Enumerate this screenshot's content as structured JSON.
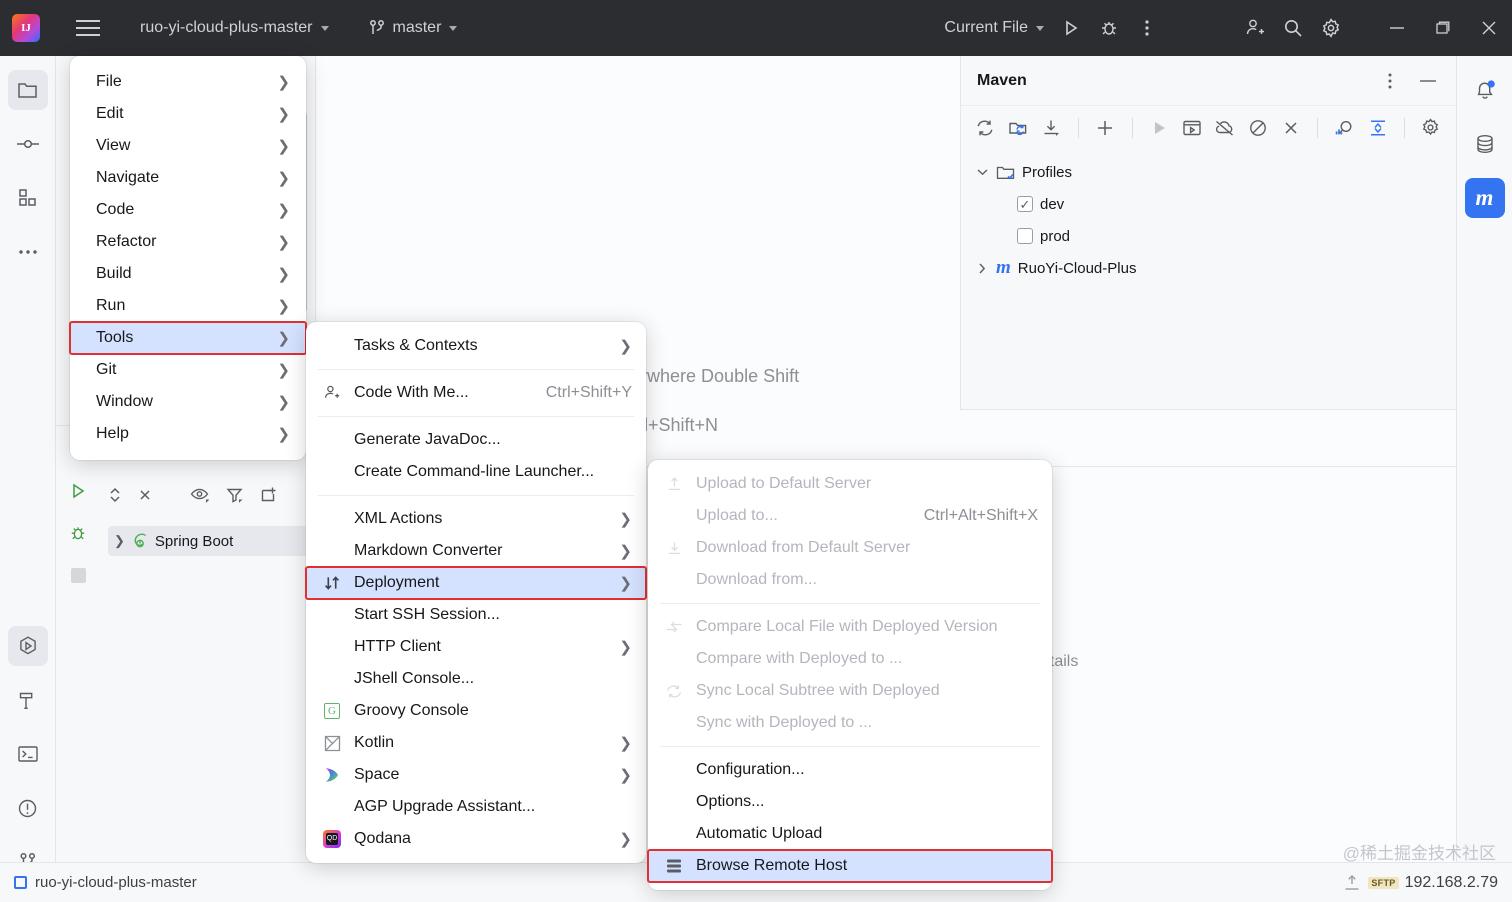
{
  "titlebar": {
    "logo_alt": "intellij-idea-logo",
    "project_name": "ruo-yi-cloud-plus-master",
    "branch": "master",
    "run_config": "Current File",
    "icons": {
      "hamburger": "hamburger-menu-icon",
      "run": "run-icon",
      "debug": "debug-icon",
      "more": "more-vertical-icon",
      "add_user": "add-user-icon",
      "search": "search-icon",
      "settings": "gear-icon",
      "minimize": "minimize-icon",
      "maximize": "maximize-icon",
      "close": "close-icon"
    }
  },
  "left_stripe": {
    "top": [
      {
        "name": "project-tool-button",
        "icon": "folder-icon",
        "active": true
      },
      {
        "name": "commit-tool-button",
        "icon": "commit-icon",
        "active": false
      },
      {
        "name": "structure-tool-button",
        "icon": "squares-icon",
        "active": false
      },
      {
        "name": "more-tool-windows-button",
        "icon": "more-horizontal-icon",
        "active": false
      }
    ],
    "bottom": [
      {
        "name": "run-tool-button",
        "icon": "run-hexagon-icon",
        "active": true
      },
      {
        "name": "build-tool-button",
        "icon": "hammer-icon",
        "active": false
      },
      {
        "name": "terminal-tool-button",
        "icon": "terminal-icon",
        "active": false
      },
      {
        "name": "problems-tool-button",
        "icon": "warning-circle-icon",
        "active": false
      },
      {
        "name": "git-tool-button",
        "icon": "branch-icon",
        "active": false
      }
    ]
  },
  "right_stripe": [
    {
      "name": "notifications-tool-button",
      "icon": "bell-icon",
      "badge": true,
      "active": false
    },
    {
      "name": "database-tool-button",
      "icon": "database-icon",
      "badge": false,
      "active": false
    },
    {
      "name": "maven-tool-button",
      "icon": "maven-m-icon",
      "label": "m",
      "badge": false,
      "active": true
    }
  ],
  "editor": {
    "hints": [
      "h Everywhere Double Shift",
      " File Ctrl+Shift+N"
    ],
    "details_fragment": "etails",
    "project_tree_fragment": "r"
  },
  "run_window": {
    "toolbar_icons": [
      "expand-collapse-icon",
      "close-all-icon",
      "eye-filter-icon",
      "filter-icon",
      "new-tab-icon"
    ],
    "gutter_icons": [
      "run-green-icon",
      "debug-green-icon",
      "stop-icon"
    ],
    "tree_item": "Spring Boot"
  },
  "maven": {
    "title": "Maven",
    "header_icons": [
      "more-vertical-icon",
      "minimize-icon"
    ],
    "toolbar": [
      {
        "name": "reload-all-maven-projects-button",
        "icon": "refresh-icon",
        "style": "normal"
      },
      {
        "name": "generate-sources-button",
        "icon": "folder-refresh-icon",
        "style": "blue"
      },
      {
        "name": "download-sources-button",
        "icon": "download-icon",
        "style": "normal"
      },
      {
        "name": "add-maven-project-button",
        "icon": "plus-icon",
        "style": "normal"
      },
      {
        "name": "run-maven-build-button",
        "icon": "play-icon",
        "style": "dim"
      },
      {
        "name": "execute-maven-goal-button",
        "icon": "terminal-window-icon",
        "style": "normal"
      },
      {
        "name": "toggle-offline-mode-button",
        "icon": "cloud-off-icon",
        "style": "normal"
      },
      {
        "name": "skip-tests-button",
        "icon": "no-entry-icon",
        "style": "normal"
      },
      {
        "name": "close-button",
        "icon": "close-x-icon",
        "style": "normal"
      },
      {
        "name": "show-dependencies-button",
        "icon": "analyze-dependencies-icon",
        "style": "blue"
      },
      {
        "name": "expand-button",
        "icon": "expand-vertical-icon",
        "style": "blue"
      },
      {
        "name": "maven-settings-button",
        "icon": "gear-icon",
        "style": "normal"
      }
    ],
    "tree": {
      "profiles_label": "Profiles",
      "profiles": [
        {
          "label": "dev",
          "checked": true
        },
        {
          "label": "prod",
          "checked": false
        }
      ],
      "project_label": "RuoYi-Cloud-Plus"
    }
  },
  "menus": {
    "main": {
      "items": [
        {
          "label": "File",
          "submenu": true,
          "selected": false
        },
        {
          "label": "Edit",
          "submenu": true,
          "selected": false
        },
        {
          "label": "View",
          "submenu": true,
          "selected": false
        },
        {
          "label": "Navigate",
          "submenu": true,
          "selected": false
        },
        {
          "label": "Code",
          "submenu": true,
          "selected": false
        },
        {
          "label": "Refactor",
          "submenu": true,
          "selected": false
        },
        {
          "label": "Build",
          "submenu": true,
          "selected": false
        },
        {
          "label": "Run",
          "submenu": true,
          "selected": false
        },
        {
          "label": "Tools",
          "submenu": true,
          "selected": true,
          "highlighted": true
        },
        {
          "label": "Git",
          "submenu": true,
          "selected": false
        },
        {
          "label": "Window",
          "submenu": true,
          "selected": false
        },
        {
          "label": "Help",
          "submenu": true,
          "selected": false
        }
      ]
    },
    "tools": {
      "items": [
        {
          "label": "Tasks & Contexts",
          "submenu": true,
          "icon": null,
          "accel": "",
          "disabled": false
        },
        {
          "sep": true
        },
        {
          "label": "Code With Me...",
          "submenu": false,
          "icon": "add-user-icon",
          "accel": "Ctrl+Shift+Y",
          "disabled": false
        },
        {
          "sep": true
        },
        {
          "label": "Generate JavaDoc...",
          "submenu": false,
          "icon": null,
          "accel": "",
          "disabled": false
        },
        {
          "label": "Create Command-line Launcher...",
          "submenu": false,
          "icon": null,
          "accel": "",
          "disabled": false
        },
        {
          "sep": true
        },
        {
          "label": "XML Actions",
          "submenu": true,
          "icon": null,
          "accel": "",
          "disabled": false
        },
        {
          "label": "Markdown Converter",
          "submenu": true,
          "icon": null,
          "accel": "",
          "disabled": false
        },
        {
          "label": "Deployment",
          "submenu": true,
          "icon": "up-down-arrows-icon",
          "accel": "",
          "disabled": false,
          "selected": true,
          "highlighted": true
        },
        {
          "label": "Start SSH Session...",
          "submenu": false,
          "icon": null,
          "accel": "",
          "disabled": false
        },
        {
          "label": "HTTP Client",
          "submenu": true,
          "icon": null,
          "accel": "",
          "disabled": false
        },
        {
          "label": "JShell Console...",
          "submenu": false,
          "icon": null,
          "accel": "",
          "disabled": false
        },
        {
          "label": "Groovy Console",
          "submenu": false,
          "icon": "groovy-icon",
          "accel": "",
          "disabled": false
        },
        {
          "label": "Kotlin",
          "submenu": true,
          "icon": "kotlin-icon",
          "accel": "",
          "disabled": false
        },
        {
          "label": "Space",
          "submenu": true,
          "icon": "space-icon",
          "accel": "",
          "disabled": false
        },
        {
          "label": "AGP Upgrade Assistant...",
          "submenu": false,
          "icon": null,
          "accel": "",
          "disabled": false
        },
        {
          "label": "Qodana",
          "submenu": true,
          "icon": "qodana-icon",
          "accel": "",
          "disabled": false
        }
      ]
    },
    "deployment": {
      "items": [
        {
          "label": "Upload to Default Server",
          "icon": "upload-icon",
          "accel": "",
          "disabled": true
        },
        {
          "label": "Upload to...",
          "icon": null,
          "accel": "Ctrl+Alt+Shift+X",
          "disabled": true
        },
        {
          "label": "Download from Default Server",
          "icon": "download-icon",
          "accel": "",
          "disabled": true
        },
        {
          "label": "Download from...",
          "icon": null,
          "accel": "",
          "disabled": true
        },
        {
          "sep": true
        },
        {
          "label": "Compare Local File with Deployed Version",
          "icon": "compare-icon",
          "accel": "",
          "disabled": true
        },
        {
          "label": "Compare with Deployed to ...",
          "icon": null,
          "accel": "",
          "disabled": true
        },
        {
          "label": "Sync Local Subtree with Deployed",
          "icon": "sync-icon",
          "accel": "",
          "disabled": true
        },
        {
          "label": "Sync with Deployed to ...",
          "icon": null,
          "accel": "",
          "disabled": true
        },
        {
          "sep": true
        },
        {
          "label": "Configuration...",
          "icon": null,
          "accel": "",
          "disabled": false
        },
        {
          "label": "Options...",
          "icon": null,
          "accel": "",
          "disabled": false
        },
        {
          "label": "Automatic Upload",
          "icon": null,
          "accel": "",
          "disabled": false
        },
        {
          "label": "Browse Remote Host",
          "icon": "remote-host-icon",
          "accel": "",
          "disabled": false,
          "selected": true,
          "highlighted": true
        }
      ]
    }
  },
  "statusbar": {
    "project_label": "ruo-yi-cloud-plus-master",
    "sftp_badge": "SFTP",
    "sftp_host": "192.168.2.79"
  },
  "watermark": "@稀土掘金技术社区",
  "colors": {
    "titlebar_bg": "#2b2d30",
    "accent_blue": "#3574f0",
    "menu_selection": "#d4e2ff",
    "highlight_red": "#e03030",
    "panel_bg": "#f7f8fa"
  }
}
